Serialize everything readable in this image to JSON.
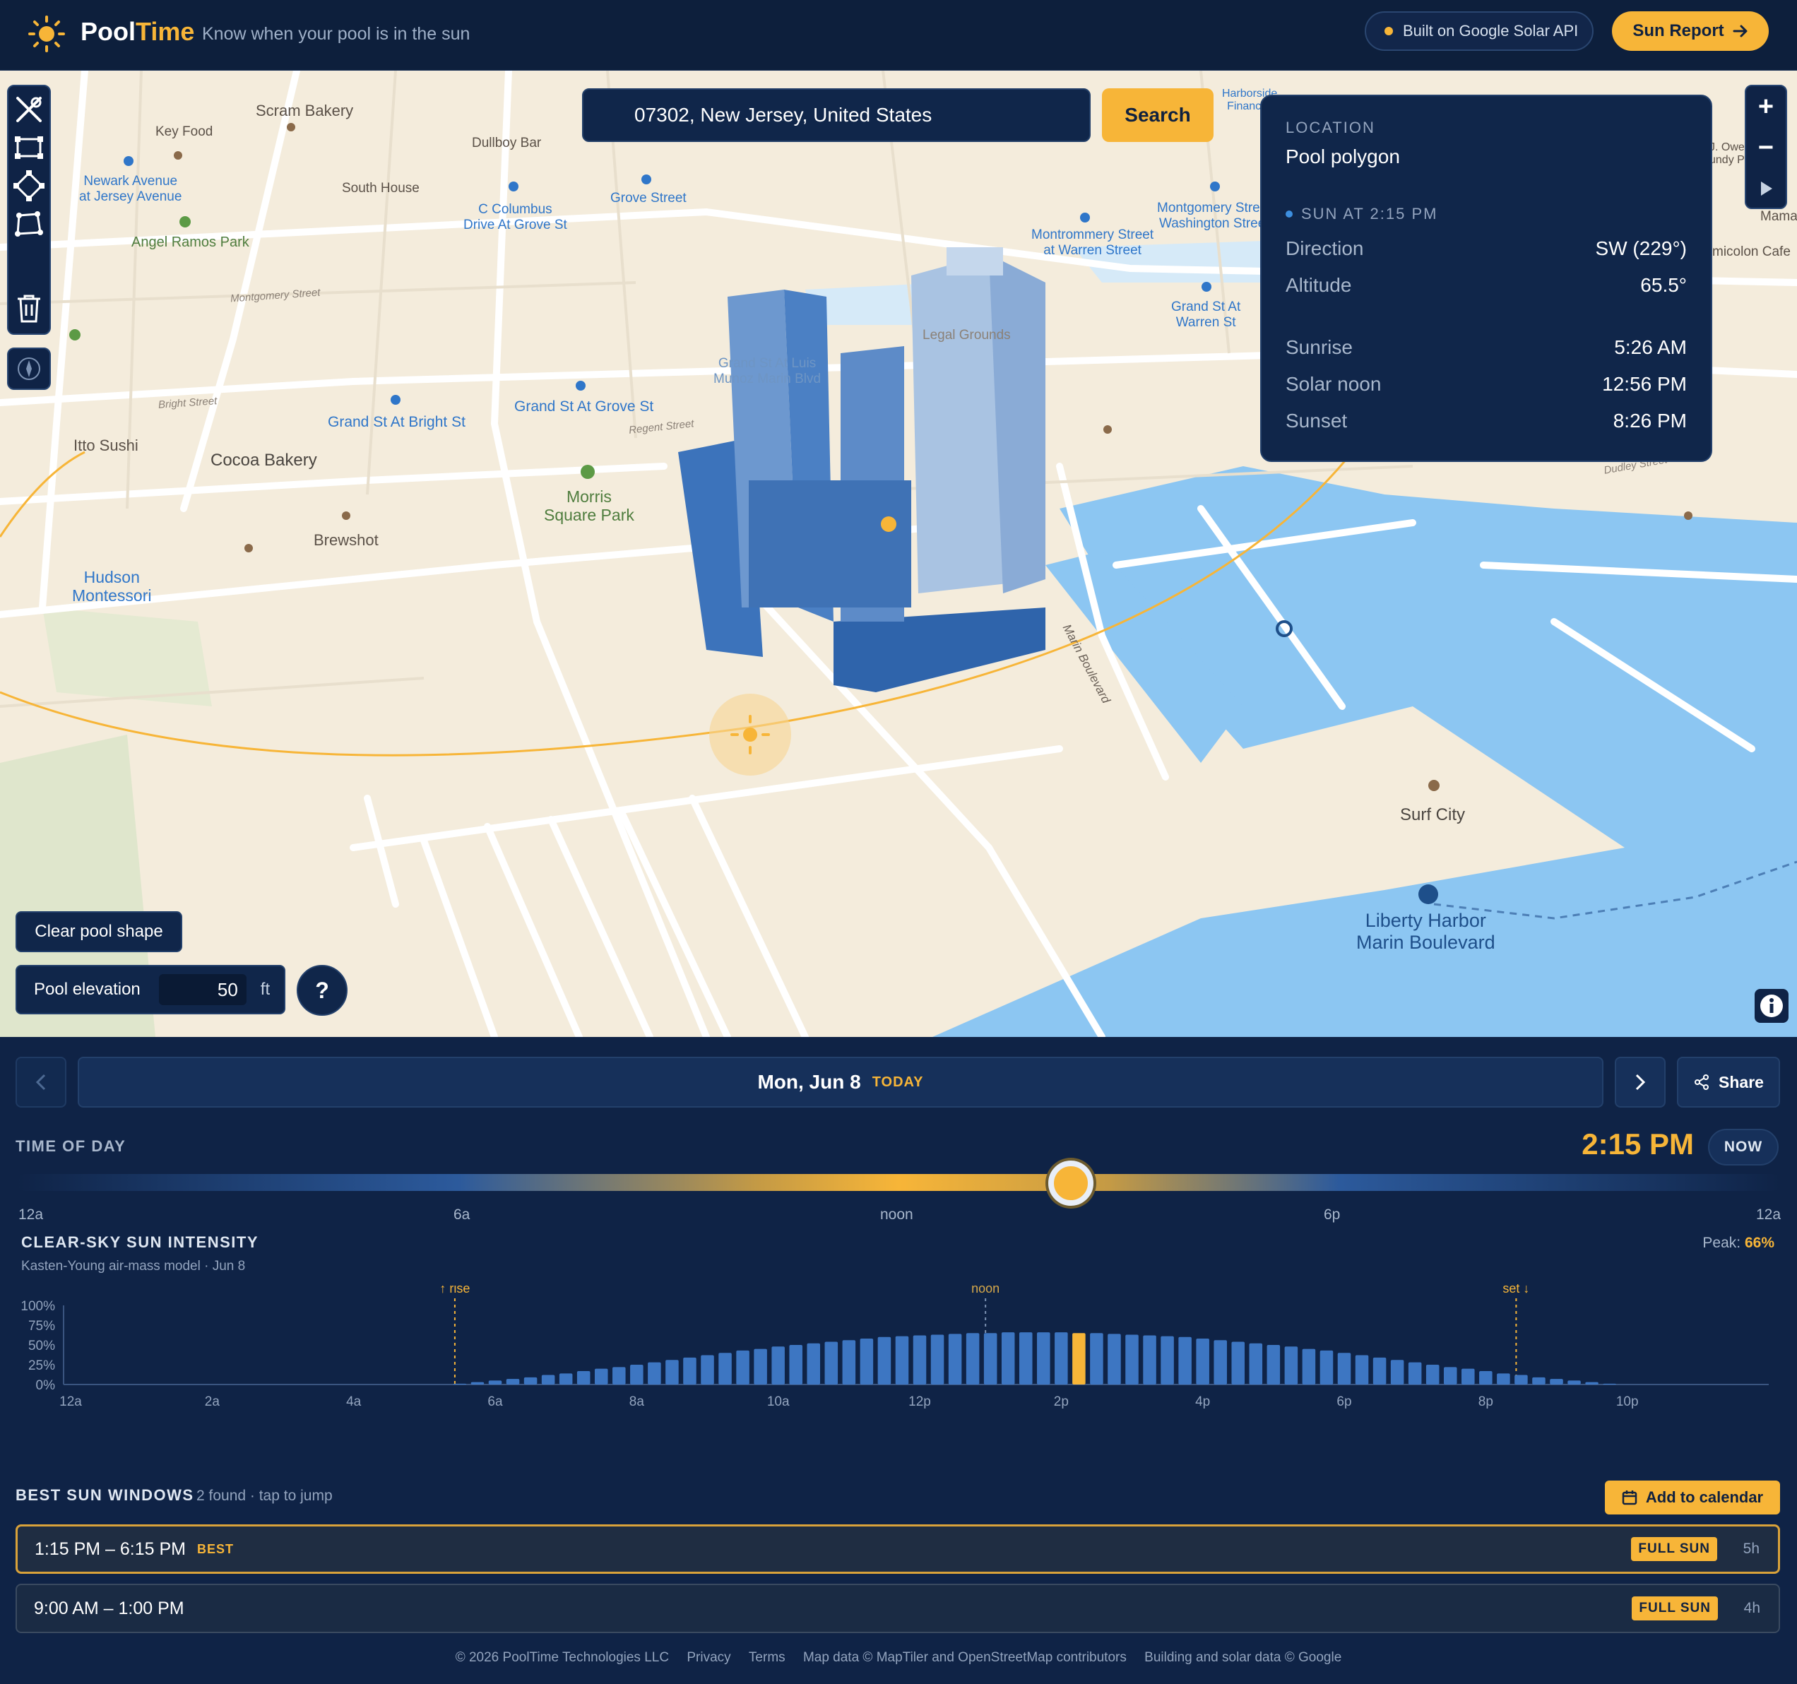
{
  "header": {
    "brand_main": "Pool",
    "brand_accent": "Time",
    "tagline": "Know when your pool is in the sun",
    "api_badge": "Built on Google Solar API",
    "report_button": "Sun Report",
    "colors": {
      "accent": "#f7b538",
      "background": "#0d1f3c"
    }
  },
  "map": {
    "search_value": "07302, New Jersey, United States",
    "search_button": "Search",
    "zoom_in": "+",
    "zoom_out": "−",
    "labels": {
      "scram_bakery": "Scram Bakery",
      "key_food": "Key Food",
      "dullboy_bar": "Dullboy Bar",
      "newark_ave": "Newark Avenue\nat Jersey Avenue",
      "south_house": "South House",
      "c_columbus": "C Columbus\nDrive At Grove St",
      "grove_street": "Grove Street",
      "angel_ramos": "Angel Ramos Park",
      "montgomery_st": "Montgomery Street",
      "grand_bright": "Grand St At Bright St",
      "grand_grove": "Grand St At Grove St",
      "bright_street": "Bright Street",
      "regent_street": "Regent Street",
      "itto_sushi": "Itto Sushi",
      "cocoa_bakery": "Cocoa Bakery",
      "morris_park": "Morris\nSquare Park",
      "brewshot": "Brewshot",
      "hudson_montessori": "Hudson\nMontessori",
      "montgomery_washington": "Montgomery Street\nWashington Street",
      "montrommery_warren": "Montrommery Street\nat Warren Street",
      "grand_warren": "Grand St At\nWarren St",
      "legal_grounds": "Legal Grounds",
      "marin_boulevard": "Marin Boulevard",
      "surf_city": "Surf City",
      "liberty_harbor": "Liberty Harbor\nMarin Boulevard",
      "harborside": "Harborside\nFinancial",
      "dudley_street": "Dudley Street",
      "micolon_cafe": "micolon Cafe",
      "mama": "Mama",
      "j_owe": "J. Owe\nundy P",
      "grand_luis": "Grand St At Luis\nMunoz Marin Blvd"
    }
  },
  "sun_panel": {
    "eyebrow": "LOCATION",
    "title": "Pool polygon",
    "sun_at": "SUN AT 2:15 PM",
    "rows": [
      {
        "k": "Direction",
        "v": "SW (229°)"
      },
      {
        "k": "Altitude",
        "v": "65.5°"
      },
      {
        "k": "Sunrise",
        "v": "5:26 AM"
      },
      {
        "k": "Solar noon",
        "v": "12:56 PM"
      },
      {
        "k": "Sunset",
        "v": "8:26 PM"
      }
    ]
  },
  "pool": {
    "clear_button": "Clear pool shape",
    "elevation_label": "Pool elevation",
    "elevation_value": "50",
    "elevation_unit": "ft",
    "help": "?"
  },
  "day": {
    "date": "Mon, Jun 8",
    "today": "TODAY",
    "share": "Share"
  },
  "time_of_day": {
    "label": "TIME OF DAY",
    "time": "2:15 PM",
    "now": "NOW",
    "ticks": [
      "12a",
      "6a",
      "noon",
      "6p",
      "12a"
    ],
    "slider_value_fraction": 0.594
  },
  "intensity": {
    "title": "CLEAR-SKY SUN INTENSITY",
    "subtitle": "Kasten-Young air-mass model · Jun 8",
    "peak_label": "Peak:",
    "peak_value": "66%"
  },
  "chart_data": {
    "type": "bar",
    "title": "CLEAR-SKY SUN INTENSITY",
    "ylim": [
      0,
      100
    ],
    "ytick_labels": [
      "100%",
      "75%",
      "50%",
      "25%",
      "0%"
    ],
    "xtick_labels": [
      "12a",
      "2a",
      "4a",
      "6a",
      "8a",
      "10a",
      "12p",
      "2p",
      "4p",
      "6p",
      "8p",
      "10p"
    ],
    "markers": [
      {
        "label": "↑ rise",
        "hour": 5.43
      },
      {
        "label": "noon",
        "hour": 12.93
      },
      {
        "label": "set ↓",
        "hour": 20.43
      }
    ],
    "interval_minutes": 15,
    "start_hour": 5.5,
    "highlight_hour": 14.25,
    "values": [
      1,
      3,
      5,
      7,
      9,
      12,
      14,
      17,
      20,
      22,
      25,
      28,
      31,
      34,
      37,
      40,
      43,
      45,
      48,
      50,
      52,
      54,
      56,
      58,
      60,
      61,
      62,
      63,
      64,
      65,
      65,
      66,
      66,
      66,
      66,
      65,
      65,
      64,
      63,
      62,
      61,
      60,
      58,
      56,
      54,
      52,
      50,
      48,
      45,
      43,
      40,
      37,
      34,
      31,
      28,
      25,
      22,
      20,
      17,
      14,
      12,
      9,
      7,
      5,
      3,
      1
    ]
  },
  "best_windows": {
    "title": "BEST SUN WINDOWS",
    "found": "2 found · tap to jump",
    "calendar_button": "Add to calendar",
    "items": [
      {
        "time": "1:15 PM – 6:15 PM",
        "best": "BEST",
        "badge": "FULL SUN",
        "duration": "5h"
      },
      {
        "time": "9:00 AM – 1:00 PM",
        "badge": "FULL SUN",
        "duration": "4h"
      }
    ]
  },
  "footer": {
    "copyright": "© 2026 PoolTime Technologies LLC",
    "privacy": "Privacy",
    "terms": "Terms",
    "map_data": "Map data © MapTiler and OpenStreetMap contributors",
    "building_data": "Building and solar data © Google"
  }
}
